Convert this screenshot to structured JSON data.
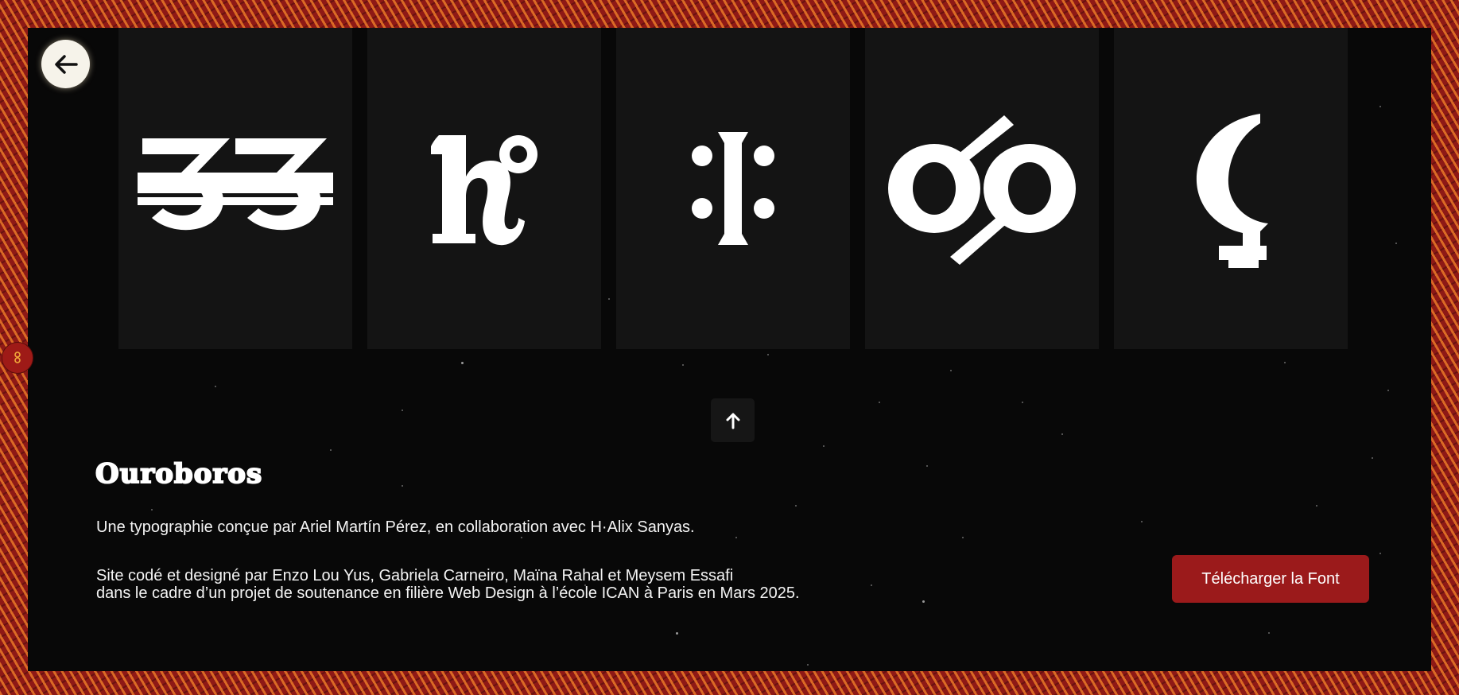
{
  "navigation": {
    "back_icon": "arrow-left-icon",
    "scroll_up_icon": "arrow-up-icon",
    "side_marker_icon": "infinity-icon"
  },
  "glyphs": [
    {
      "name": "glyph-double-three-crossed"
    },
    {
      "name": "glyph-hook-with-circle"
    },
    {
      "name": "glyph-bar-with-four-dots"
    },
    {
      "name": "glyph-two-rings-slashed"
    },
    {
      "name": "glyph-crescent-cross"
    }
  ],
  "title": "Ouroboros",
  "credits": {
    "line1": "Une typographie conçue par Ariel Martín Pérez, en collaboration avec H·Alix Sanyas.",
    "line2": "Site codé et designé par Enzo Lou Yus, Gabriela Carneiro, Maïna Rahal et Meysem Essafi",
    "line3": "dans le cadre d’un projet de soutenance en filière Web Design à l’école ICAN à Paris en Mars 2025."
  },
  "download_label": "Télécharger la Font",
  "colors": {
    "border": "#8e1916",
    "background": "#080808",
    "card": "#141414",
    "accent_button": "#9b1a1b",
    "text": "#f4f4f4"
  }
}
